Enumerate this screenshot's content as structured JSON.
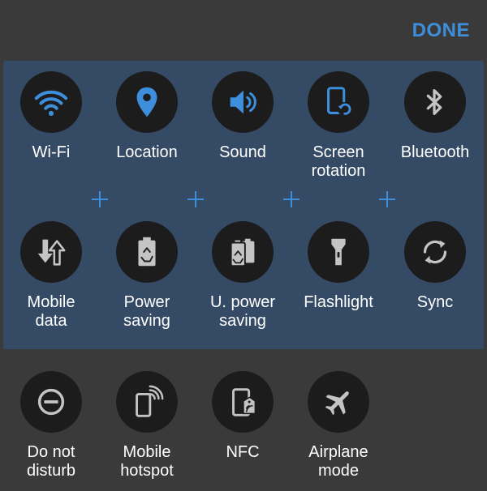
{
  "header": {
    "done_label": "DONE"
  },
  "colors": {
    "accent": "#3d8fdc",
    "background": "#3a3a3a",
    "panel": "#354a64",
    "tile": "#1c1c1c",
    "icon_inactive": "#c4c4c4"
  },
  "active_tiles": [
    {
      "label": "Wi-Fi",
      "icon": "wifi-icon",
      "state": "on"
    },
    {
      "label": "Location",
      "icon": "location-pin-icon",
      "state": "on"
    },
    {
      "label": "Sound",
      "icon": "speaker-icon",
      "state": "on"
    },
    {
      "label": "Screen\nrotation",
      "icon": "screen-rotation-icon",
      "state": "on"
    },
    {
      "label": "Bluetooth",
      "icon": "bluetooth-icon",
      "state": "off"
    },
    {
      "label": "Mobile\ndata",
      "icon": "mobile-data-icon",
      "state": "off"
    },
    {
      "label": "Power\nsaving",
      "icon": "power-saving-battery-icon",
      "state": "off"
    },
    {
      "label": "U. power\nsaving",
      "icon": "ultra-power-saving-icon",
      "state": "off"
    },
    {
      "label": "Flashlight",
      "icon": "flashlight-icon",
      "state": "off"
    },
    {
      "label": "Sync",
      "icon": "sync-icon",
      "state": "off"
    }
  ],
  "inactive_tiles": [
    {
      "label": "Do not\ndisturb",
      "icon": "do-not-disturb-icon",
      "state": "off"
    },
    {
      "label": "Mobile\nhotspot",
      "icon": "mobile-hotspot-icon",
      "state": "off"
    },
    {
      "label": "NFC",
      "icon": "nfc-icon",
      "state": "off"
    },
    {
      "label": "Airplane\nmode",
      "icon": "airplane-icon",
      "state": "off"
    }
  ]
}
